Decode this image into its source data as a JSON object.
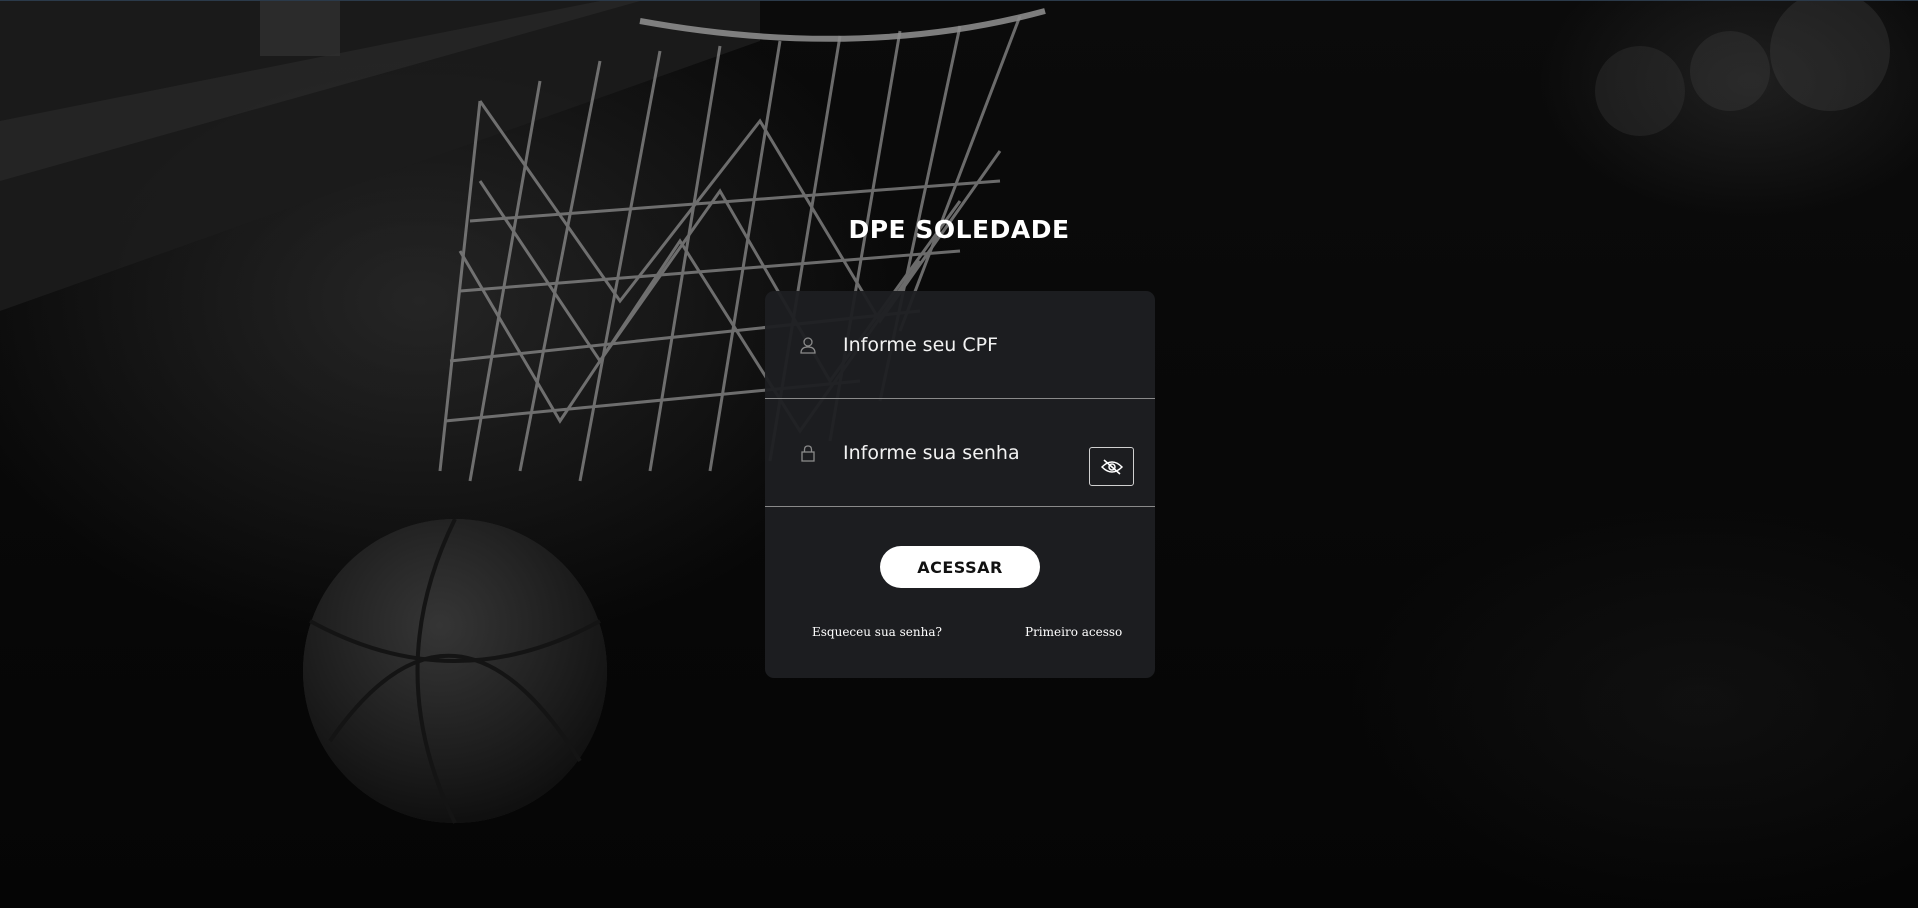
{
  "app": {
    "title": "DPE SOLEDADE"
  },
  "login": {
    "cpf_placeholder": "Informe seu CPF",
    "password_placeholder": "Informe sua senha",
    "submit_label": "ACESSAR",
    "forgot_password_label": "Esqueceu sua senha?",
    "first_access_label": "Primeiro acesso"
  },
  "icons": {
    "user": "user-icon",
    "lock": "lock-icon",
    "toggle_visibility": "eye-slash-icon"
  },
  "colors": {
    "card_background": "#1e1f22",
    "button_background": "#ffffff",
    "text": "#ffffff"
  }
}
